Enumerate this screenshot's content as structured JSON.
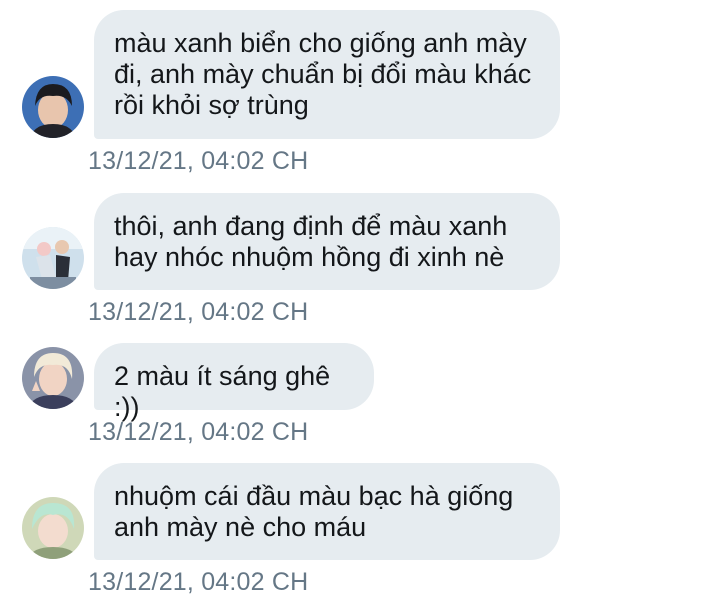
{
  "messages": [
    {
      "text": "màu xanh biển cho giống anh mày đi, anh mày chuẩn bị đổi màu khác rồi khỏi sợ trùng",
      "timestamp": "13/12/21, 04:02 CH",
      "avatar_icon": "user-avatar-icon"
    },
    {
      "text": "thôi, anh đang định để màu xanh hay nhóc nhuộm hồng đi xinh nè",
      "timestamp": "13/12/21, 04:02 CH",
      "avatar_icon": "user-avatar-icon"
    },
    {
      "text": "2 màu ít sáng ghê :))",
      "timestamp": "13/12/21, 04:02 CH",
      "avatar_icon": "user-avatar-icon"
    },
    {
      "text": "nhuộm cái đầu màu bạc hà giống anh mày nè cho máu",
      "timestamp": "13/12/21, 04:02 CH",
      "avatar_icon": "user-avatar-icon"
    }
  ],
  "colors": {
    "bubble": "#e6ecf0",
    "text": "#14171a",
    "timestamp": "#657786"
  }
}
